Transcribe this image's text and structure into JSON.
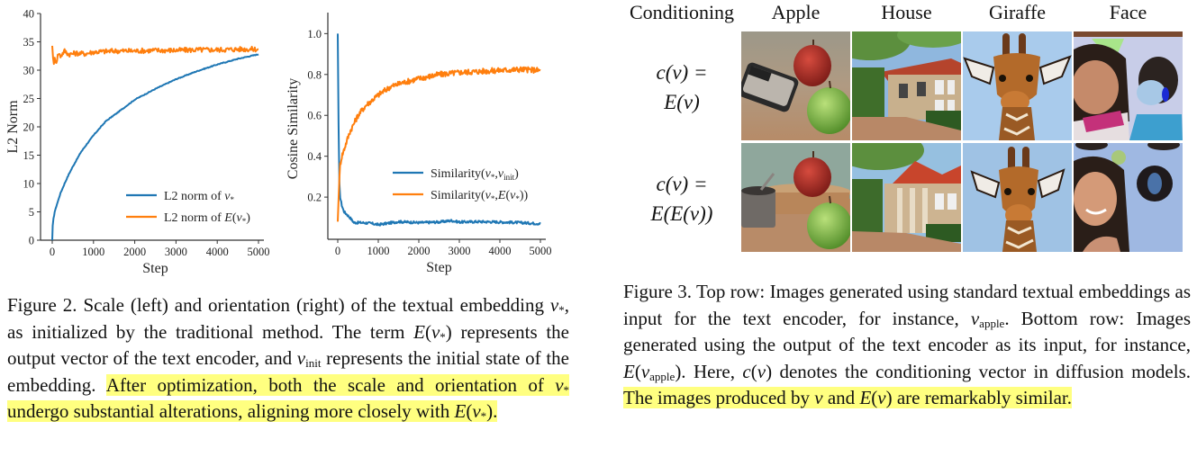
{
  "figure2": {
    "chart_left": {
      "type": "line",
      "ylabel": "L2 Norm",
      "xlabel": "Step",
      "xlim": [
        0,
        5000
      ],
      "ylim": [
        0,
        40
      ],
      "xticks": [
        "0",
        "1000",
        "2000",
        "3000",
        "4000",
        "5000"
      ],
      "yticks": [
        "0",
        "5",
        "10",
        "15",
        "20",
        "25",
        "30",
        "35",
        "40"
      ],
      "legend_position": "bottom-right",
      "legend": [
        "L2 norm of v*",
        "L2 norm of E(v*)"
      ]
    },
    "chart_right": {
      "type": "line",
      "ylabel": "Cosine Similarity",
      "xlabel": "Step",
      "xlim": [
        0,
        5000
      ],
      "ylim": [
        0.02,
        1.05
      ],
      "xticks": [
        "0",
        "1000",
        "2000",
        "3000",
        "4000",
        "5000"
      ],
      "yticks": [
        "0.2",
        "0.4",
        "0.6",
        "0.8",
        "1.0"
      ],
      "legend_position": "center-right",
      "legend": [
        "Similarity(v*,v_init)",
        "Similarity(v*,E(v*))"
      ]
    },
    "caption": {
      "plain": "Figure 2. Scale (left) and orientation (right) of the textual embedding v*, as initialized by the traditional method. The term E(v*) represents the output vector of the text encoder, and v_init represents the initial state of the embedding.",
      "highlighted": "After optimization, both the scale and orientation of v* undergo substantial alterations, aligning more closely with E(v*)."
    }
  },
  "chart_data": [
    {
      "type": "line",
      "title": "",
      "xlabel": "Step",
      "ylabel": "L2 Norm",
      "xlim": [
        0,
        5000
      ],
      "ylim": [
        0,
        40
      ],
      "grid": false,
      "legend": "bottom-right",
      "series": [
        {
          "name": "L2 norm of v*",
          "color": "#1f77b4",
          "x": [
            0,
            10,
            30,
            60,
            100,
            200,
            300,
            400,
            500,
            700,
            1000,
            1300,
            1600,
            2000,
            2500,
            3000,
            3500,
            4000,
            4500,
            5000
          ],
          "y": [
            0,
            2.5,
            3.8,
            5.0,
            6.0,
            8.3,
            10.0,
            11.6,
            13.0,
            15.6,
            18.5,
            21.0,
            22.6,
            24.8,
            26.7,
            28.4,
            29.8,
            31.0,
            32.0,
            32.8
          ]
        },
        {
          "name": "L2 norm of E(v*)",
          "color": "#ff7f0e",
          "x": [
            0,
            20,
            40,
            60,
            100,
            150,
            200,
            300,
            400,
            600,
            800,
            1000,
            1500,
            2000,
            2500,
            3000,
            3500,
            4000,
            4500,
            5000
          ],
          "y": [
            34.3,
            32.5,
            30.8,
            32.0,
            31.5,
            33.0,
            32.5,
            33.4,
            32.8,
            33.0,
            32.9,
            33.2,
            33.4,
            33.4,
            33.5,
            33.5,
            33.6,
            33.6,
            33.7,
            33.7
          ]
        }
      ]
    },
    {
      "type": "line",
      "title": "",
      "xlabel": "Step",
      "ylabel": "Cosine Similarity",
      "xlim": [
        0,
        5000
      ],
      "ylim": [
        0.02,
        1.05
      ],
      "grid": false,
      "legend": "center-right",
      "series": [
        {
          "name": "Similarity(v*,v_init)",
          "color": "#1f77b4",
          "x": [
            0,
            20,
            40,
            60,
            100,
            150,
            200,
            300,
            400,
            600,
            800,
            1000,
            1500,
            2000,
            2500,
            2800,
            3000,
            3500,
            4000,
            4500,
            5000
          ],
          "y": [
            1.0,
            0.55,
            0.27,
            0.2,
            0.16,
            0.13,
            0.12,
            0.1,
            0.075,
            0.075,
            0.072,
            0.065,
            0.08,
            0.075,
            0.078,
            0.085,
            0.078,
            0.08,
            0.078,
            0.075,
            0.07
          ]
        },
        {
          "name": "Similarity(v*,E(v*))",
          "color": "#ff7f0e",
          "x": [
            0,
            20,
            40,
            60,
            100,
            150,
            200,
            300,
            400,
            500,
            700,
            1000,
            1300,
            1600,
            2000,
            2500,
            3000,
            3500,
            4000,
            4500,
            5000
          ],
          "y": [
            0.08,
            0.2,
            0.28,
            0.36,
            0.4,
            0.43,
            0.46,
            0.52,
            0.56,
            0.6,
            0.65,
            0.7,
            0.74,
            0.76,
            0.78,
            0.8,
            0.81,
            0.815,
            0.82,
            0.825,
            0.82
          ]
        }
      ]
    }
  ],
  "figure3": {
    "header": {
      "conditioning": "Conditioning",
      "columns": [
        "Apple",
        "House",
        "Giraffe",
        "Face"
      ]
    },
    "rows": [
      {
        "label_line1": "c(v) =",
        "label_line2": "E(v)"
      },
      {
        "label_line1": "c(v) =",
        "label_line2": "E(E(v))"
      }
    ],
    "images": [
      [
        "apple-with-phone",
        "house-two-story",
        "giraffe-head",
        "woman-and-masked-boy"
      ],
      [
        "apple-with-tin-can",
        "house-with-columns",
        "giraffe-head",
        "smiling-woman"
      ]
    ],
    "caption": {
      "plain": "Figure 3. Top row: Images generated using standard textual embeddings as input for the text encoder, for instance, v_apple. Bottom row: Images generated using the output of the text encoder as its input, for instance, E(v_apple). Here, c(v) denotes the conditioning vector in diffusion models.",
      "highlighted": "The images produced by v and E(v) are remarkably similar."
    }
  },
  "colors": {
    "blue_series": "#1f77b4",
    "orange_series": "#ff7f0e",
    "highlight": "#ffff80"
  }
}
